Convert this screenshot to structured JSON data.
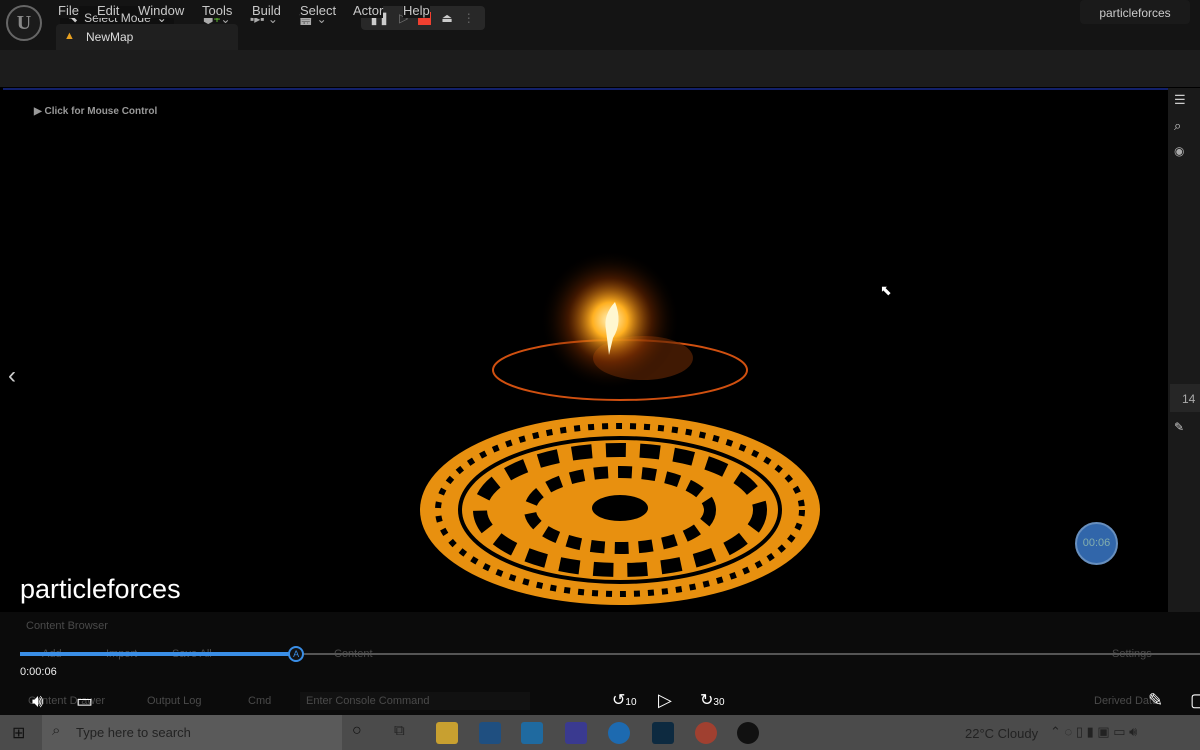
{
  "menu": [
    "File",
    "Edit",
    "Window",
    "Tools",
    "Build",
    "Select",
    "Actor",
    "Help"
  ],
  "tab": {
    "label": "NewMap"
  },
  "project_name": "particleforces",
  "toolbar": {
    "select_mode": "Select Mode"
  },
  "viewport": {
    "hint": "Click for Mouse Control"
  },
  "right_panel": {
    "count": "14"
  },
  "content_browser": {
    "tab": "Content Browser",
    "add": "Add",
    "import": "Import",
    "save_all": "Save All",
    "breadcrumb": "Content",
    "settings": "Settings",
    "drawer": "Content Drawer",
    "output_log": "Output Log",
    "cmd": "Cmd",
    "console_placeholder": "Enter Console Command",
    "derived": "Derived Data"
  },
  "video": {
    "title": "particleforces",
    "time": "0:00:06",
    "progress_percent": 23.4,
    "timer_badge": "00:06",
    "rewind": "10",
    "forward": "30"
  },
  "taskbar": {
    "search_placeholder": "Type here to search",
    "weather": "22°C  Cloudy"
  },
  "colors": {
    "accent": "#3a8ee6",
    "glow": "#f5a020"
  }
}
